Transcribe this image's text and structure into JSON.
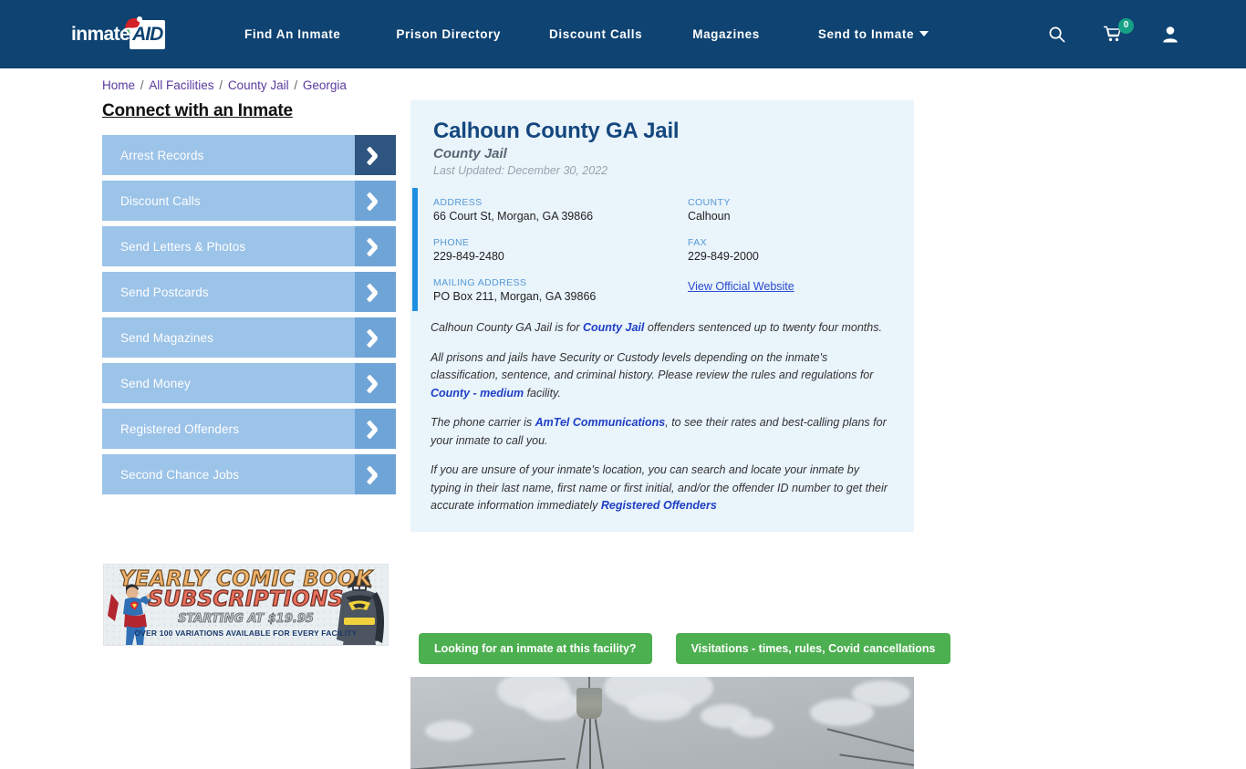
{
  "nav": {
    "logo": {
      "text_primary": "inmate",
      "text_accent": "AID",
      "icon": "santa-hat-icon"
    },
    "links": [
      {
        "label": "Find An Inmate"
      },
      {
        "label": "Prison Directory"
      },
      {
        "label": "Discount Calls"
      },
      {
        "label": "Magazines"
      },
      {
        "label": "Send to Inmate",
        "has_dropdown": true
      }
    ],
    "icons": [
      {
        "name": "search-icon"
      },
      {
        "name": "cart-icon",
        "badge": "0",
        "badge_color": "#16a085"
      },
      {
        "name": "user-account-icon"
      }
    ],
    "background": "#0e4372"
  },
  "breadcrumb": {
    "items": [
      "Home",
      "All Facilities",
      "County Jail",
      "Georgia"
    ],
    "separator": "/",
    "link_color": "#5a3a9e"
  },
  "sidebar": {
    "title": "Connect with an Inmate",
    "items": [
      {
        "label": "Arrest Records",
        "active": true
      },
      {
        "label": "Discount Calls",
        "active": false
      },
      {
        "label": "Send Letters & Photos",
        "active": false
      },
      {
        "label": "Send Postcards",
        "active": false
      },
      {
        "label": "Send Magazines",
        "active": false
      },
      {
        "label": "Send Money",
        "active": false
      },
      {
        "label": "Registered Offenders",
        "active": false
      },
      {
        "label": "Second Chance Jobs",
        "active": false
      }
    ]
  },
  "ad": {
    "title_line1": "YEARLY COMIC BOOK",
    "title_line2": "SUBSCRIPTIONS",
    "subtitle": "STARTING AT $19.95",
    "footnote": "OVER 100 VARIATIONS AVAILABLE FOR EVERY FACILITY"
  },
  "facility": {
    "name": "Calhoun County GA Jail",
    "type": "County Jail",
    "last_updated": "Last Updated: December 30, 2022",
    "contact": {
      "address_label": "ADDRESS",
      "address_value": "66 Court St, Morgan, GA 39866",
      "phone_label": "PHONE",
      "phone_value": "229-849-2480",
      "mailing_label": "MAILING ADDRESS",
      "mailing_value": "PO Box 211, Morgan, GA 39866",
      "county_label": "COUNTY",
      "county_value": "Calhoun",
      "fax_label": "FAX",
      "fax_value": "229-849-2000",
      "website_link": "View Official Website"
    },
    "paragraphs": {
      "p1_a": "Calhoun County GA Jail is for ",
      "p1_link": "County Jail",
      "p1_b": " offenders sentenced up to twenty four months.",
      "p2_a": "All prisons and jails have Security or Custody levels depending on the inmate's classification, sentence, and criminal history. Please review the rules and regulations for ",
      "p2_link": "County - medium",
      "p2_b": " facility.",
      "p3_a": "The phone carrier is ",
      "p3_link": "AmTel Communications",
      "p3_b": ", to see their rates and best-calling plans for your inmate to call you.",
      "p4_a": "If you are unsure of your inmate's location, you can search and locate your inmate by typing in their last name, first name or first initial, and/or the offender ID number to get their accurate information immediately ",
      "p4_link": "Registered Offenders"
    }
  },
  "actions": {
    "find_inmate": "Looking for an inmate at this facility?",
    "visitations": "Visitations - times, rules, Covid cancellations",
    "button_color": "#4caf50"
  },
  "photo": {
    "alt": "water-tower-cloudy-sky"
  }
}
